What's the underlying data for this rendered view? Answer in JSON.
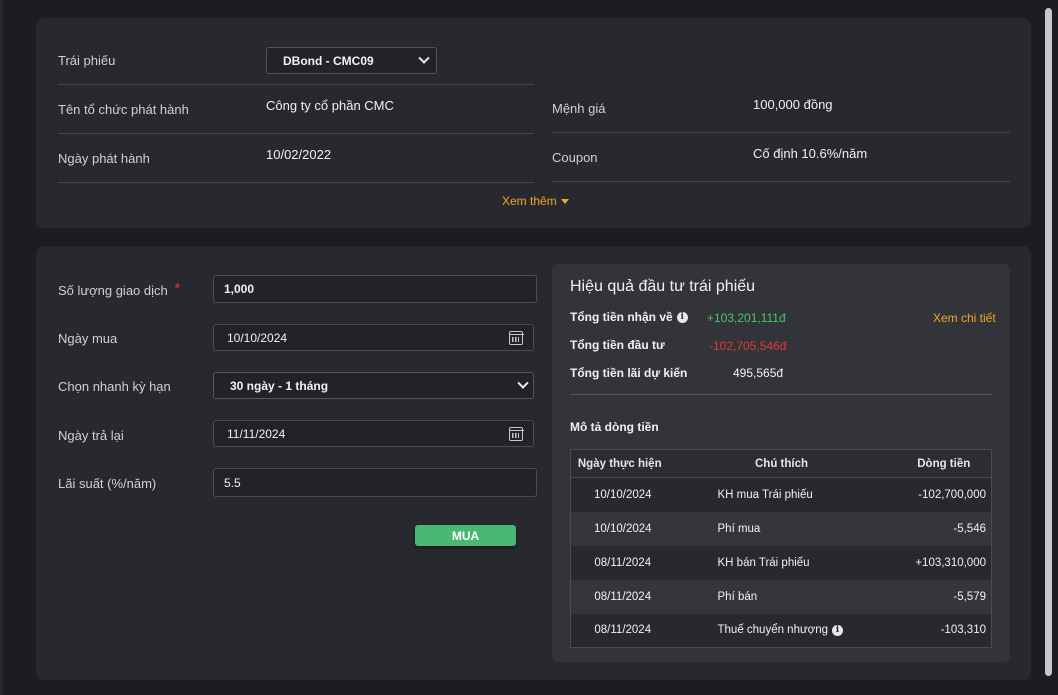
{
  "bond_info": {
    "bond_label": "Trái phiếu",
    "bond_selected": "DBond - CMC09",
    "issuer_label": "Tên tổ chức phát hành",
    "issuer_value": "Công ty cổ phần CMC",
    "face_value_label": "Mệnh giá",
    "face_value_value": "100,000 đồng",
    "issue_date_label": "Ngày phát hành",
    "issue_date_value": "10/02/2022",
    "coupon_label": "Coupon",
    "coupon_value": "Cố định 10.6%/năm",
    "see_more": "Xem thêm"
  },
  "form": {
    "quantity_label": "Số lượng giao dịch",
    "required_mark": "*",
    "quantity_value": "1,000",
    "buy_date_label": "Ngày mua",
    "buy_date_value": "10/10/2024",
    "term_label": "Chọn nhanh kỳ hạn",
    "term_value": "30 ngày - 1 tháng",
    "return_date_label": "Ngày trả lại",
    "return_date_value": "11/11/2024",
    "rate_label": "Lãi suất (%/năm)",
    "rate_value": "5.5",
    "buy_button": "MUA"
  },
  "performance": {
    "title": "Hiệu quả đầu tư trái phiếu",
    "total_received_label": "Tổng tiền nhận về",
    "total_received_value": "+103,201,111đ",
    "view_detail": "Xem chi tiết",
    "total_invested_label": "Tổng tiền đầu tư",
    "total_invested_value": "-102,705,546đ",
    "expected_interest_label": "Tổng tiền lãi dự kiến",
    "expected_interest_value": "495,565đ",
    "cashflow_title": "Mô tả dòng tiền",
    "columns": [
      "Ngày thực hiện",
      "Chú thích",
      "Dòng tiền"
    ],
    "rows": [
      {
        "date": "10/10/2024",
        "note": "KH mua Trái phiếu",
        "amount": "-102,700,000",
        "sign": "neg"
      },
      {
        "date": "10/10/2024",
        "note": "Phí mua",
        "amount": "-5,546",
        "sign": "neg"
      },
      {
        "date": "08/11/2024",
        "note": "KH bán Trái phiếu",
        "amount": "+103,310,000",
        "sign": "pos"
      },
      {
        "date": "08/11/2024",
        "note": "Phí bán",
        "amount": "-5,579",
        "sign": "neg"
      },
      {
        "date": "08/11/2024",
        "note": "Thuế chuyển nhượng",
        "amount": "-103,310",
        "sign": "neg",
        "info": true
      }
    ]
  },
  "colors": {
    "accent": "#f5a623",
    "positive": "#4ec46d",
    "negative": "#e0383b",
    "buy_button": "#4ab874"
  }
}
